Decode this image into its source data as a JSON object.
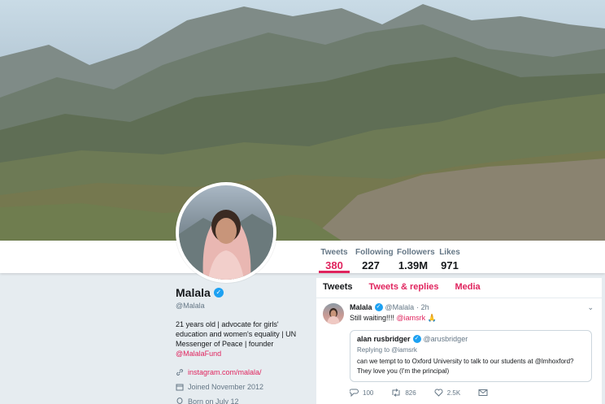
{
  "profile": {
    "name": "Malala",
    "handle": "@Malala",
    "bio_text": "21 years old | advocate for girls' education and women's equality | UN Messenger of Peace | founder",
    "bio_link": "@MalalaFund",
    "website": "instagram.com/malala/",
    "joined": "Joined November 2012",
    "born": "Born on July 12"
  },
  "stats": [
    {
      "label": "Tweets",
      "value": "380"
    },
    {
      "label": "Following",
      "value": "227"
    },
    {
      "label": "Followers",
      "value": "1.39M"
    },
    {
      "label": "Likes",
      "value": "971"
    }
  ],
  "tabs": [
    {
      "label": "Tweets"
    },
    {
      "label": "Tweets & replies"
    },
    {
      "label": "Media"
    }
  ],
  "tweet": {
    "name": "Malala",
    "handle": "@Malala",
    "time": "· 2h",
    "text": "Still waiting!!!! ",
    "mention": "@iamsrk",
    "emoji": "🙏",
    "quote": {
      "name": "alan rusbridger",
      "handle": "@arusbridger",
      "replying": "Replying to @iamsrk",
      "text": "can we tempt to to Oxford University to talk to our students at @lmhoxford? They love you (I'm the principal)"
    },
    "replies": "100",
    "retweets": "826",
    "likes": "2.5K"
  },
  "colors": {
    "accent": "#e0245e",
    "verified": "#1da1f2",
    "muted": "#657786",
    "page_bg": "#e6ecf0"
  }
}
